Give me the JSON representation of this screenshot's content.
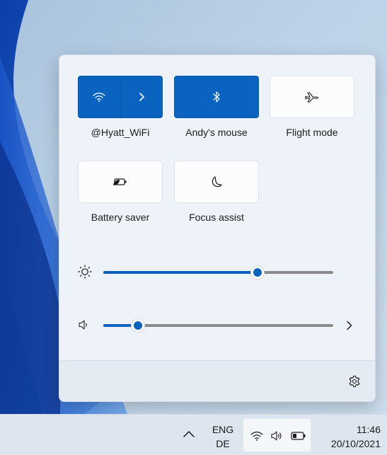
{
  "quick_settings": {
    "tiles": [
      {
        "label": "@Hyatt_WiFi",
        "icon": "wifi-icon",
        "state": "on"
      },
      {
        "label": "Andy's mouse",
        "icon": "bluetooth-icon",
        "state": "on"
      },
      {
        "label": "Flight mode",
        "icon": "airplane-icon",
        "state": "off"
      },
      {
        "label": "Battery saver",
        "icon": "battery-saver-icon",
        "state": "off"
      },
      {
        "label": "Focus assist",
        "icon": "moon-icon",
        "state": "off"
      }
    ],
    "brightness": {
      "icon": "brightness-icon",
      "level": 0.67
    },
    "volume": {
      "icon": "speaker-icon",
      "level": 0.15,
      "more_icon": "chevron-right-icon"
    },
    "settings_icon": "gear-icon"
  },
  "taskbar": {
    "overflow_icon": "chevron-up-icon",
    "language_line1": "ENG",
    "language_line2": "DE",
    "tray_icons": [
      "wifi-icon",
      "speaker-icon",
      "battery-icon"
    ],
    "time": "11:46",
    "date": "20/10/2021"
  },
  "colors": {
    "accent": "#0a64bf",
    "panel_bg": "#eef3f9",
    "taskbar_bg": "#dde6ef"
  }
}
